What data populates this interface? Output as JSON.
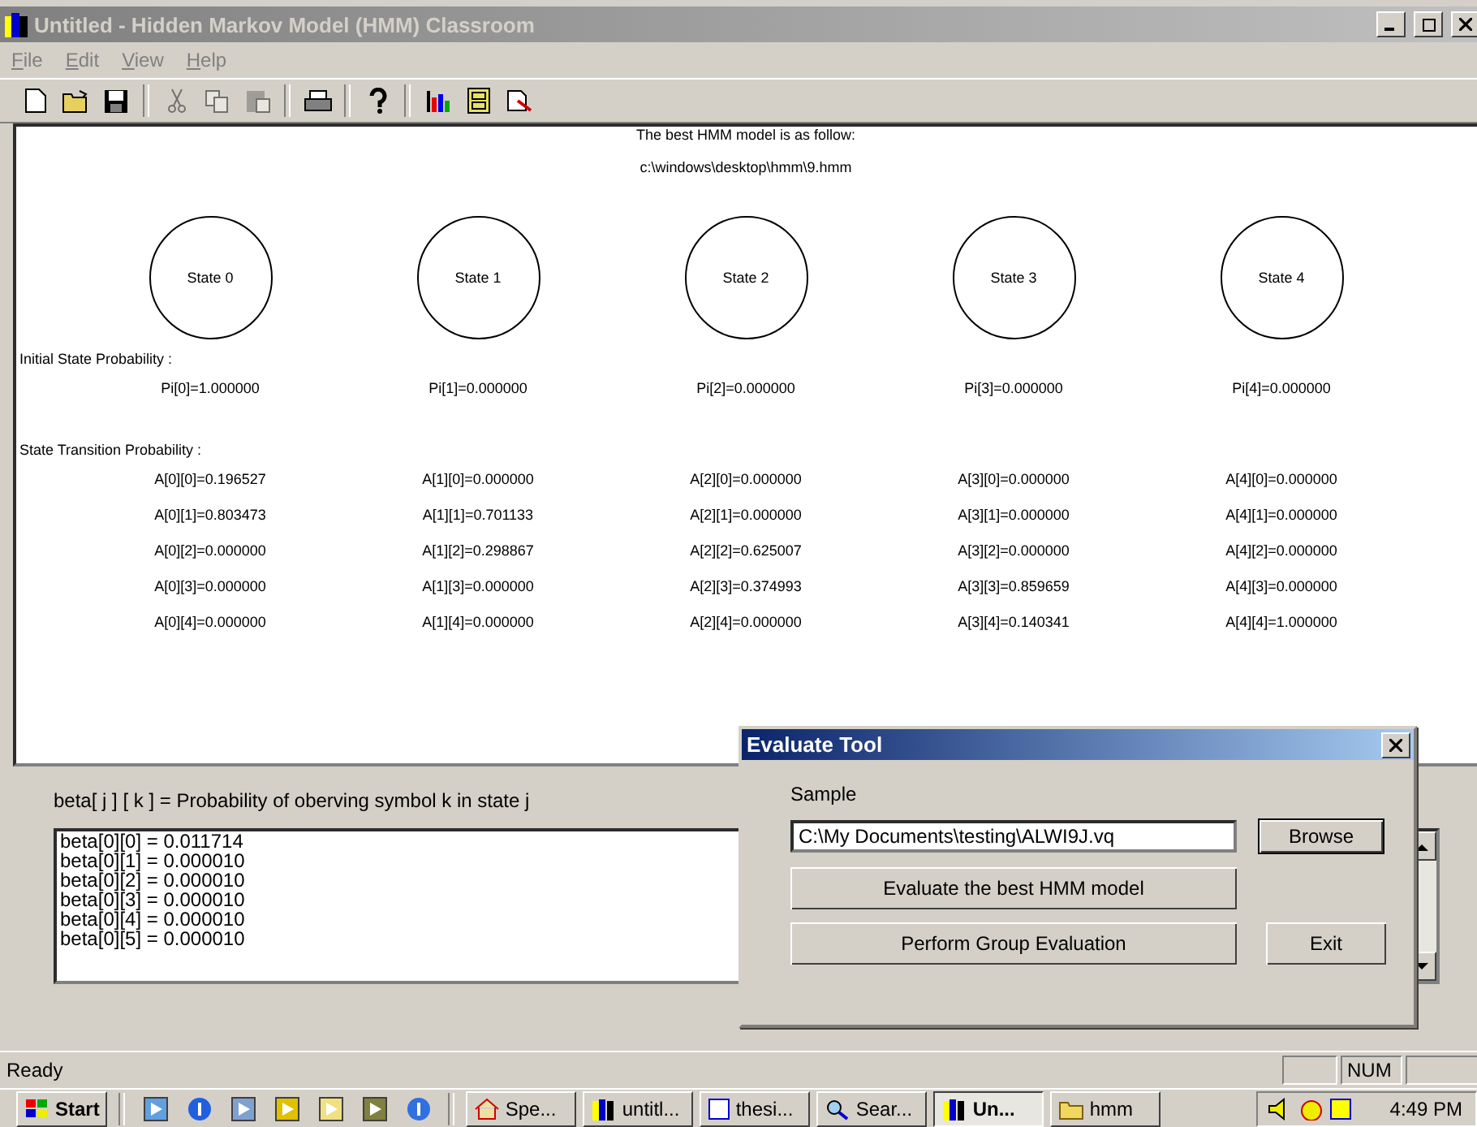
{
  "window": {
    "title": "Untitled - Hidden Markov Model (HMM) Classroom"
  },
  "menu": [
    "File",
    "Edit",
    "View",
    "Help"
  ],
  "toolbar": [
    {
      "kind": "new",
      "disabled": false
    },
    {
      "kind": "open",
      "disabled": false
    },
    {
      "kind": "save",
      "disabled": false
    },
    {
      "kind": "sep"
    },
    {
      "kind": "cut",
      "disabled": true
    },
    {
      "kind": "copy",
      "disabled": true
    },
    {
      "kind": "paste",
      "disabled": true
    },
    {
      "kind": "sep"
    },
    {
      "kind": "print",
      "disabled": false
    },
    {
      "kind": "sep"
    },
    {
      "kind": "help",
      "disabled": false
    },
    {
      "kind": "sep"
    },
    {
      "kind": "chart",
      "disabled": false
    },
    {
      "kind": "cabinet",
      "disabled": false
    },
    {
      "kind": "wizard",
      "disabled": false
    }
  ],
  "canvas": {
    "heading": "The best HMM model is as follow:",
    "path": "c:\\windows\\desktop\\hmm\\9.hmm",
    "initial_label": "Initial State Probability :",
    "transition_label": "State Transition Probability :",
    "states": [
      {
        "label": "State 0",
        "pi": "Pi[0]=1.000000",
        "transitions": [
          "A[0][0]=0.196527",
          "A[0][1]=0.803473",
          "A[0][2]=0.000000",
          "A[0][3]=0.000000",
          "A[0][4]=0.000000"
        ]
      },
      {
        "label": "State 1",
        "pi": "Pi[1]=0.000000",
        "transitions": [
          "A[1][0]=0.000000",
          "A[1][1]=0.701133",
          "A[1][2]=0.298867",
          "A[1][3]=0.000000",
          "A[1][4]=0.000000"
        ]
      },
      {
        "label": "State 2",
        "pi": "Pi[2]=0.000000",
        "transitions": [
          "A[2][0]=0.000000",
          "A[2][1]=0.000000",
          "A[2][2]=0.625007",
          "A[2][3]=0.374993",
          "A[2][4]=0.000000"
        ]
      },
      {
        "label": "State 3",
        "pi": "Pi[3]=0.000000",
        "transitions": [
          "A[3][0]=0.000000",
          "A[3][1]=0.000000",
          "A[3][2]=0.000000",
          "A[3][3]=0.859659",
          "A[3][4]=0.140341"
        ]
      },
      {
        "label": "State 4",
        "pi": "Pi[4]=0.000000",
        "transitions": [
          "A[4][0]=0.000000",
          "A[4][1]=0.000000",
          "A[4][2]=0.000000",
          "A[4][3]=0.000000",
          "A[4][4]=1.000000"
        ]
      }
    ]
  },
  "beta": {
    "caption": "beta[ j ] [ k ] = Probability of oberving symbol k in state j",
    "lines": [
      "beta[0][0] = 0.011714",
      "beta[0][1] = 0.000010",
      "beta[0][2] = 0.000010",
      "beta[0][3] = 0.000010",
      "beta[0][4] = 0.000010",
      "beta[0][5] = 0.000010"
    ]
  },
  "dialog": {
    "title": "Evaluate Tool",
    "sample_label": "Sample",
    "sample_value": "C:\\My Documents\\testing\\ALWI9J.vq",
    "browse": "Browse",
    "evaluate": "Evaluate the best HMM model",
    "group": "Perform Group Evaluation",
    "exit": "Exit"
  },
  "status_bar": {
    "text": "Ready",
    "indicator": "NUM"
  },
  "taskbar": {
    "start": "Start",
    "quick_launch": [
      {
        "kind": "notepad"
      },
      {
        "kind": "browser"
      },
      {
        "kind": "sync"
      },
      {
        "kind": "media"
      },
      {
        "kind": "search"
      },
      {
        "kind": "clock"
      },
      {
        "kind": "info"
      }
    ],
    "tasks": [
      {
        "label": "Spe...",
        "kind": "home",
        "selected": false
      },
      {
        "label": "untitl...",
        "kind": "app",
        "selected": false
      },
      {
        "label": "thesi...",
        "kind": "doc",
        "selected": false
      },
      {
        "label": "Sear...",
        "kind": "search",
        "selected": false
      },
      {
        "label": "Un...",
        "kind": "app",
        "selected": true
      },
      {
        "label": "hmm",
        "kind": "folder",
        "selected": false
      }
    ],
    "clock": "4:49 PM"
  }
}
